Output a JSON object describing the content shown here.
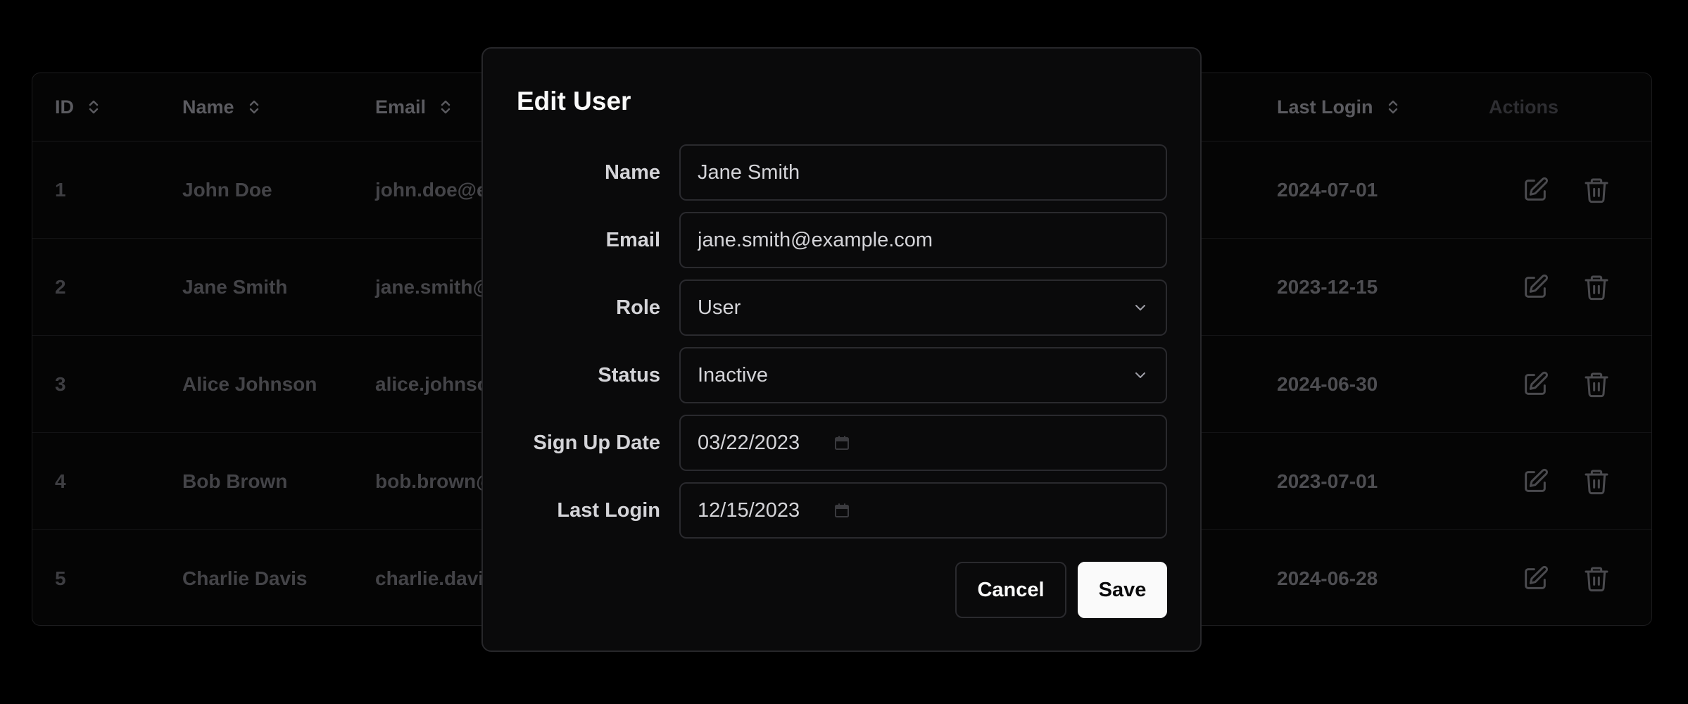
{
  "table": {
    "headers": {
      "id": "ID",
      "name": "Name",
      "email": "Email",
      "last_login": "Last Login",
      "actions": "Actions"
    },
    "rows": [
      {
        "id": "1",
        "name": "John Doe",
        "email": "john.doe@e",
        "last_login": "2024-07-01"
      },
      {
        "id": "2",
        "name": "Jane Smith",
        "email": "jane.smith@",
        "last_login": "2023-12-15"
      },
      {
        "id": "3",
        "name": "Alice Johnson",
        "email": "alice.johnso",
        "last_login": "2024-06-30"
      },
      {
        "id": "4",
        "name": "Bob Brown",
        "email": "bob.brown@",
        "last_login": "2023-07-01"
      },
      {
        "id": "5",
        "name": "Charlie Davis",
        "email": "charlie.davi",
        "last_login": "2024-06-28"
      }
    ],
    "icons": {
      "sort": "sort-icon",
      "edit": "edit-icon",
      "delete": "trash-icon"
    }
  },
  "modal": {
    "title": "Edit User",
    "fields": {
      "name": {
        "label": "Name",
        "value": "Jane Smith"
      },
      "email": {
        "label": "Email",
        "value": "jane.smith@example.com"
      },
      "role": {
        "label": "Role",
        "value": "User"
      },
      "status": {
        "label": "Status",
        "value": "Inactive"
      },
      "sign_up_date": {
        "label": "Sign Up Date",
        "value": "03/22/2023"
      },
      "last_login": {
        "label": "Last Login",
        "value": "12/15/2023"
      }
    },
    "buttons": {
      "cancel": "Cancel",
      "save": "Save"
    }
  },
  "colors": {
    "background": "#000000",
    "modal_bg": "#0a0a0b",
    "border": "#27272a",
    "primary_button": "#fafafa"
  }
}
